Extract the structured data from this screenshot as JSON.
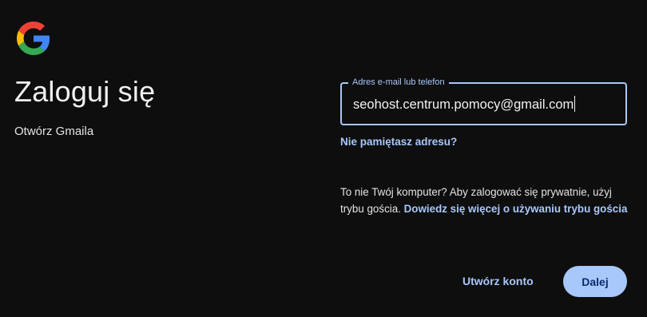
{
  "logo": {
    "icon": "google-g-icon",
    "colors": [
      "#4285F4",
      "#EA4335",
      "#FBBC05",
      "#34A853"
    ]
  },
  "heading": "Zaloguj się",
  "subheading": "Otwórz Gmaila",
  "email_field": {
    "label": "Adres e-mail lub telefon",
    "value": "seohost.centrum.pomocy@gmail.com"
  },
  "forgot_link": "Nie pamiętasz adresu?",
  "guest": {
    "text": "To nie Twój komputer? Aby zalogować się prywatnie, użyj trybu gościa. ",
    "link": "Dowiedz się więcej o używaniu trybu gościa"
  },
  "buttons": {
    "create_account": "Utwórz konto",
    "next": "Dalej"
  },
  "colors": {
    "background": "#0e0e0e",
    "accent": "#a8c7fa",
    "button_text": "#062e6f"
  }
}
